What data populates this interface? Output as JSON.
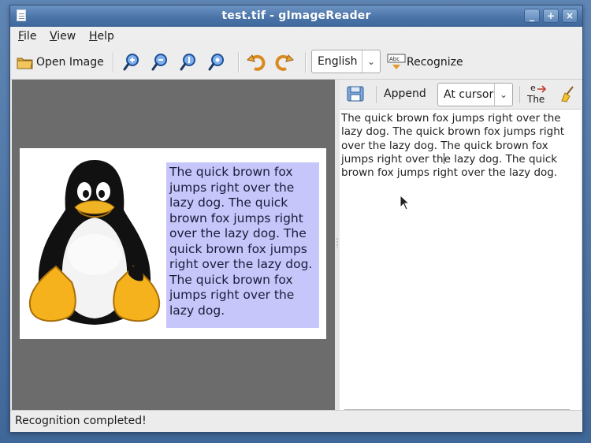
{
  "window": {
    "title": "test.tif - gImageReader",
    "buttons": [
      "_",
      "+",
      "×"
    ]
  },
  "menu": [
    {
      "mnemonic": "F",
      "rest": "ile"
    },
    {
      "mnemonic": "V",
      "rest": "iew"
    },
    {
      "mnemonic": "H",
      "rest": "elp"
    }
  ],
  "toolbar": {
    "open_image": "Open Image",
    "language": "English",
    "recognize": "Recognize"
  },
  "document": {
    "selection_text": "The quick brown fox jumps right over the lazy dog. The quick brown fox jumps right over the lazy dog. The quick brown fox jumps right over the lazy dog. The quick brown fox jumps right over the lazy dog."
  },
  "output": {
    "append_label": "Append",
    "insert_mode": "At cursor",
    "text_before_cursor": "The quick brown fox jumps right over the lazy dog. The quick brown fox jumps right over the lazy dog. The quick brown fox jumps right over th",
    "text_after_cursor": "e lazy dog. The quick brown fox jumps right over the lazy dog.",
    "swap_icon_top": "e",
    "swap_icon_bottom": "The"
  },
  "status": "Recognition completed!"
}
